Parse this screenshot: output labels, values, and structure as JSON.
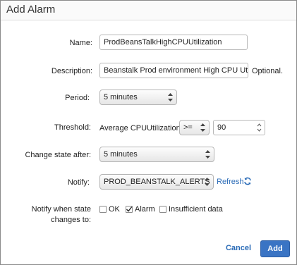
{
  "dialog": {
    "title": "Add Alarm"
  },
  "form": {
    "name": {
      "label": "Name:",
      "value": "ProdBeansTalkHighCPUUtilization"
    },
    "description": {
      "label": "Description:",
      "value": "Beanstalk Prod environment High CPU Utili",
      "hint": "Optional."
    },
    "period": {
      "label": "Period:",
      "value": "5 minutes"
    },
    "threshold": {
      "label": "Threshold:",
      "metric": "Average CPUUtilization",
      "operator": ">=",
      "value": "90"
    },
    "change_state": {
      "label": "Change state after:",
      "value": "5 minutes"
    },
    "notify": {
      "label": "Notify:",
      "value": "PROD_BEANSTALK_ALERTS",
      "refresh_label": "Refresh",
      "refresh_icon": "refresh-icon"
    },
    "notify_states": {
      "label_line1": "Notify when state",
      "label_line2": "changes to:",
      "options": [
        {
          "label": "OK",
          "checked": false
        },
        {
          "label": "Alarm",
          "checked": true
        },
        {
          "label": "Insufficient data",
          "checked": false
        }
      ]
    }
  },
  "buttons": {
    "cancel": "Cancel",
    "add": "Add"
  },
  "colors": {
    "link": "#2a6bb7",
    "primary": "#3a74c4"
  }
}
